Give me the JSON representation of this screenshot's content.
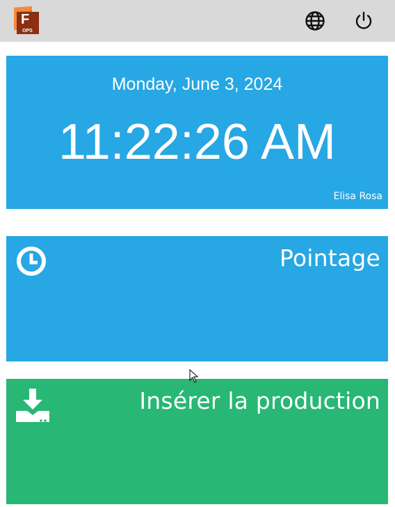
{
  "header": {
    "logo": {
      "letter": "F",
      "caption": "OPS",
      "icon": "fusion-ops-logo"
    },
    "language_icon": "globe-icon",
    "power_icon": "power-icon"
  },
  "clock": {
    "date": "Monday, June 3, 2024",
    "time": "11:22:26 AM",
    "user": "Elisa Rosa"
  },
  "tiles": [
    {
      "label": "Pointage",
      "icon": "clock-icon",
      "color": "#27a7e4"
    },
    {
      "label": "Insérer la production",
      "icon": "download-icon",
      "color": "#28b774"
    }
  ],
  "colors": {
    "topbar": "#d9d9d9",
    "clock_card": "#27a7e4",
    "logo_orange": "#f26b1d",
    "logo_dark": "#8c2e12"
  }
}
